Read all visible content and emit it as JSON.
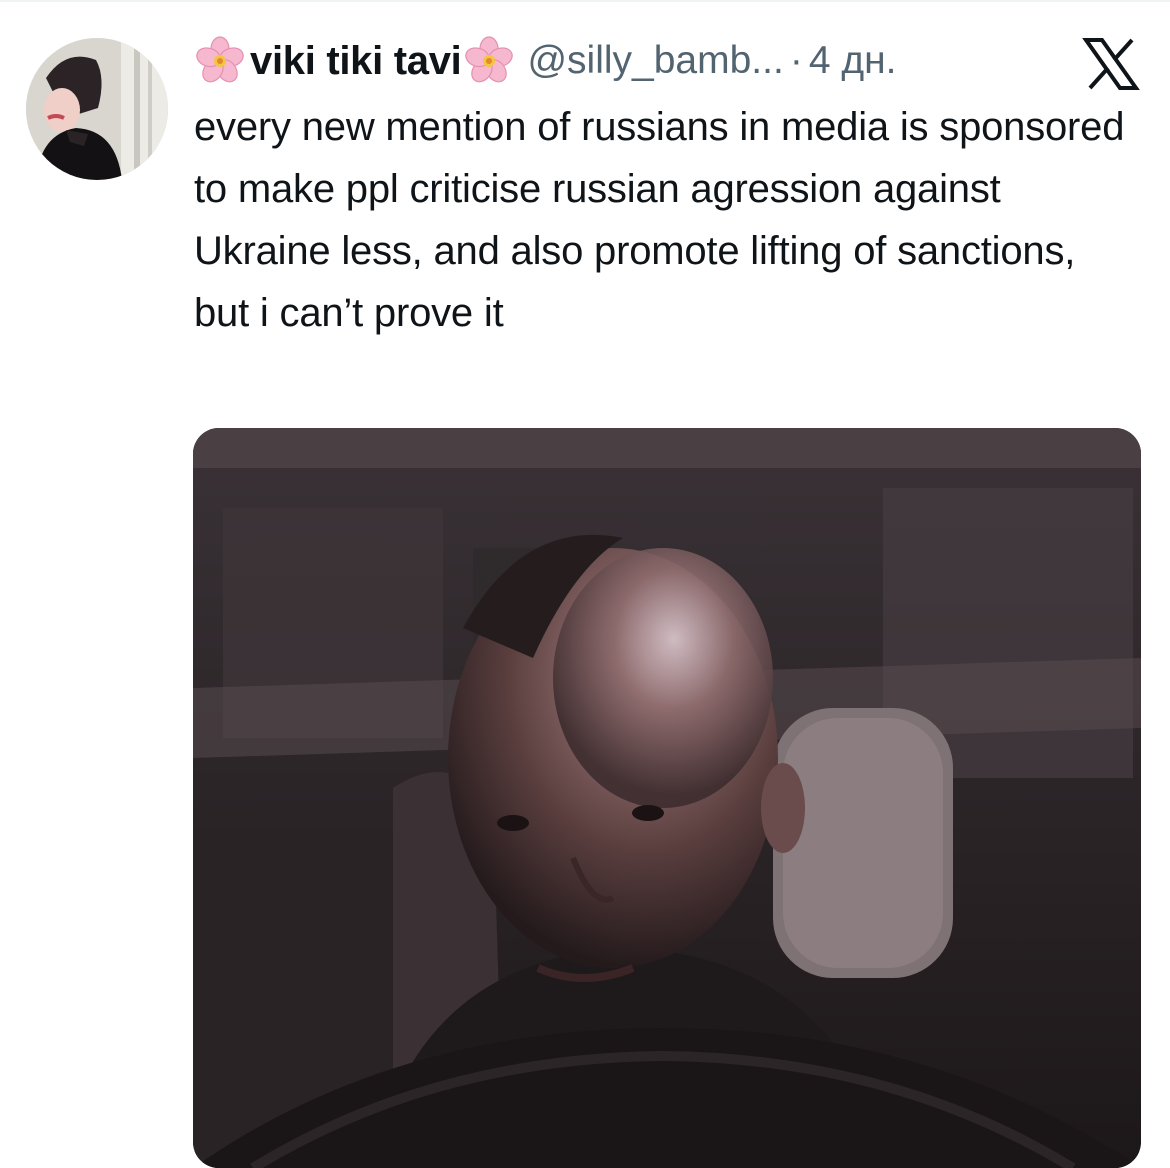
{
  "tweet": {
    "display_name": "viki tiki tavi",
    "name_emoji_left": "cherry-blossom-icon",
    "name_emoji_right": "cherry-blossom-icon",
    "handle": "@silly_bamb...",
    "separator": "·",
    "time": "4 дн.",
    "text": "every new mention of russians in media is sponsored to make ppl criticise russian agression against Ukraine less, and also promote lifting of sanctions, but i can’t prove it",
    "platform_icon": "x-logo-icon",
    "media": "man-driving-car-at-night-photo"
  },
  "colors": {
    "text_primary": "#0f1419",
    "text_secondary": "#536471",
    "flower_pink": "#f6b8cf",
    "flower_center": "#f4c542"
  }
}
